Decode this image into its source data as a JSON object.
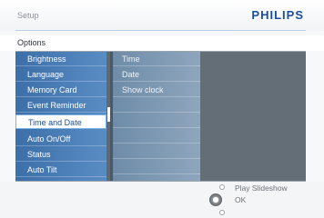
{
  "header": {
    "breadcrumb": "Setup",
    "brand": "PHILIPS"
  },
  "section": {
    "title": "Options"
  },
  "menu": {
    "items": [
      {
        "label": "Brightness"
      },
      {
        "label": "Language"
      },
      {
        "label": "Memory Card"
      },
      {
        "label": "Event Reminder"
      },
      {
        "label": "Time and Date",
        "selected": true
      },
      {
        "label": "Auto On/Off"
      },
      {
        "label": "Status"
      },
      {
        "label": "Auto  Tilt"
      }
    ],
    "submenu": [
      {
        "label": "Time"
      },
      {
        "label": "Date"
      },
      {
        "label": "Show clock"
      }
    ]
  },
  "footer": {
    "play_label": "Play Slideshow",
    "ok_label": "OK"
  },
  "colors": {
    "brand": "#1d4fa0",
    "menu_blue": "#3c6ea8",
    "panel_gray": "#646e77"
  }
}
